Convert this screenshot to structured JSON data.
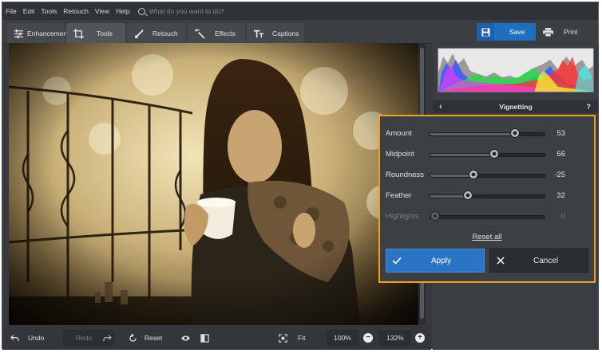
{
  "menu": {
    "items": [
      "File",
      "Edit",
      "Tools",
      "Retouch",
      "View",
      "Help"
    ],
    "search_placeholder": "What do you want to do?"
  },
  "tabs": [
    {
      "label": "Enhancement",
      "icon": "sliders-icon"
    },
    {
      "label": "Tools",
      "icon": "crop-icon",
      "active": true
    },
    {
      "label": "Retouch",
      "icon": "brush-icon"
    },
    {
      "label": "Effects",
      "icon": "magic-wand-icon"
    },
    {
      "label": "Captions",
      "icon": "text-icon"
    }
  ],
  "header_actions": {
    "save_label": "Save",
    "print_label": "Print"
  },
  "panel": {
    "title": "Vignetting",
    "help": "?",
    "back": "‹"
  },
  "vignetting": {
    "sliders": [
      {
        "label": "Amount",
        "value": "53",
        "position": 0.74,
        "enabled": true
      },
      {
        "label": "Midpoint",
        "value": "56",
        "position": 0.56,
        "enabled": true
      },
      {
        "label": "Roundness",
        "value": "-25",
        "position": 0.38,
        "enabled": true
      },
      {
        "label": "Feather",
        "value": "32",
        "position": 0.33,
        "enabled": true
      },
      {
        "label": "Highlights",
        "value": "0",
        "position": 0.0,
        "enabled": false
      }
    ],
    "reset_all_label": "Reset all",
    "apply_label": "Apply",
    "cancel_label": "Cancel"
  },
  "bottom": {
    "undo_label": "Undo",
    "redo_label": "Redo",
    "reset_label": "Reset",
    "fit_label": "Fit",
    "zoom_100_label": "100%",
    "zoom_value": "132%"
  },
  "colors": {
    "accent_blue": "#2a74c6",
    "popup_border": "#f0a020",
    "background": "#36393d"
  }
}
